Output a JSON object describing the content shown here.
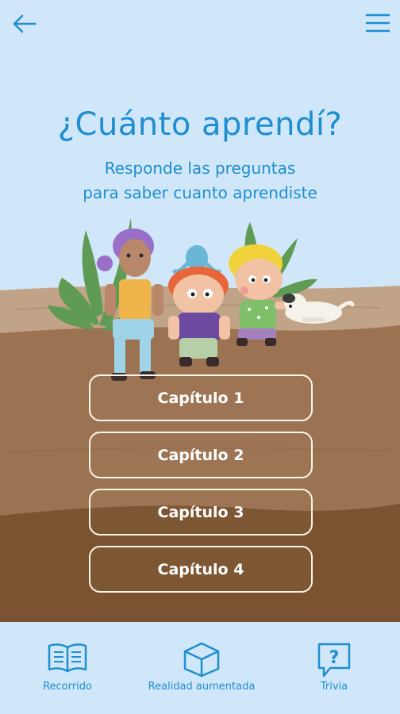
{
  "header": {
    "back_icon": "arrow-left-icon",
    "menu_icon": "hamburger-menu-icon"
  },
  "main": {
    "title": "¿Cuánto aprendí?",
    "subtitle_line1": "Responde las preguntas",
    "subtitle_line2": "para saber cuanto aprendiste",
    "chapters": [
      {
        "label": "Capítulo 1"
      },
      {
        "label": "Capítulo 2"
      },
      {
        "label": "Capítulo 3"
      },
      {
        "label": "Capítulo 4"
      }
    ]
  },
  "bottom_nav": {
    "items": [
      {
        "label": "Recorrido",
        "icon": "open-book-icon"
      },
      {
        "label": "Realidad aumentada",
        "icon": "cube-icon"
      },
      {
        "label": "Trivia",
        "icon": "question-bubble-icon"
      }
    ]
  },
  "colors": {
    "sky": "#cfe7f8",
    "accent": "#1f8ed0",
    "ground_light": "#b48d6c",
    "ground_dark": "#6e4a2a"
  }
}
